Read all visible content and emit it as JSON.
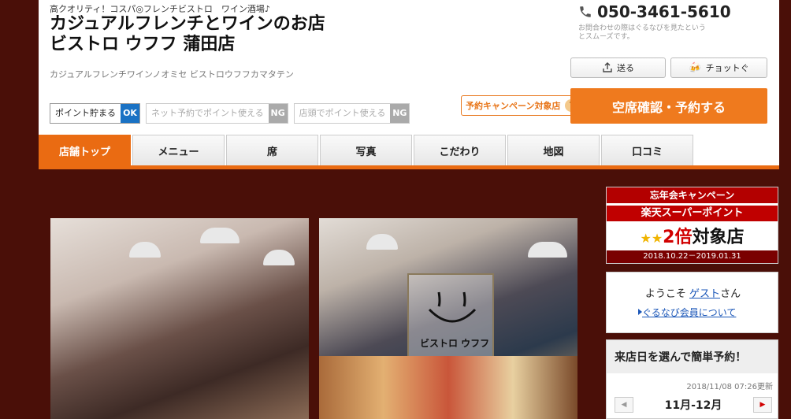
{
  "header": {
    "tagline": "高クオリティ！コスパ◎フレンチビストロ　ワイン酒場♪",
    "title_line1": "カジュアルフレンチとワインのお店",
    "title_line2": "ビストロ ウフフ 蒲田店",
    "kana": "カジュアルフレンチワインノオミセ ビストロウフフカマタテン"
  },
  "points": [
    {
      "label": "ポイント貯まる",
      "value": "OK"
    },
    {
      "label": "ネット予約でポイント使える",
      "value": "NG"
    },
    {
      "label": "店頭でポイント使える",
      "value": "NG"
    }
  ],
  "contact": {
    "phone": "050-3461-5610",
    "note": "お問合わせの際はぐるなびを見たというとスムーズです。"
  },
  "actions": {
    "send": "送る",
    "choi": "チョットぐ",
    "campaign": "予約キャンペーン対象店",
    "campaign_help": "?",
    "reserve": "空席確認・予約する"
  },
  "nav": {
    "tabs": [
      "店舗トップ",
      "メニュー",
      "席",
      "写真",
      "こだわり",
      "地図",
      "口コミ"
    ],
    "active": 0
  },
  "photos": {
    "logo_text": "ビストロ ウフフ"
  },
  "sidebar": {
    "banner": {
      "title": "忘年会キャンペーン",
      "line": "楽天スーパーポイント",
      "big_multiplier": "2倍",
      "big_suffix": "対象店",
      "dates": "2018.10.22－2019.01.31"
    },
    "welcome": {
      "prefix": "ようこそ ",
      "guest": "ゲスト",
      "suffix": "さん",
      "member_link": "ぐるなび会員について"
    },
    "calendar": {
      "title": "来店日を選んで簡単予約！",
      "updated": "2018/11/08 07:26更新",
      "month": "11月-12月"
    }
  },
  "colors": {
    "accent": "#ea6b12",
    "background": "#4a0f08",
    "ok": "#1a72c4",
    "ng": "#aaaaaa"
  }
}
